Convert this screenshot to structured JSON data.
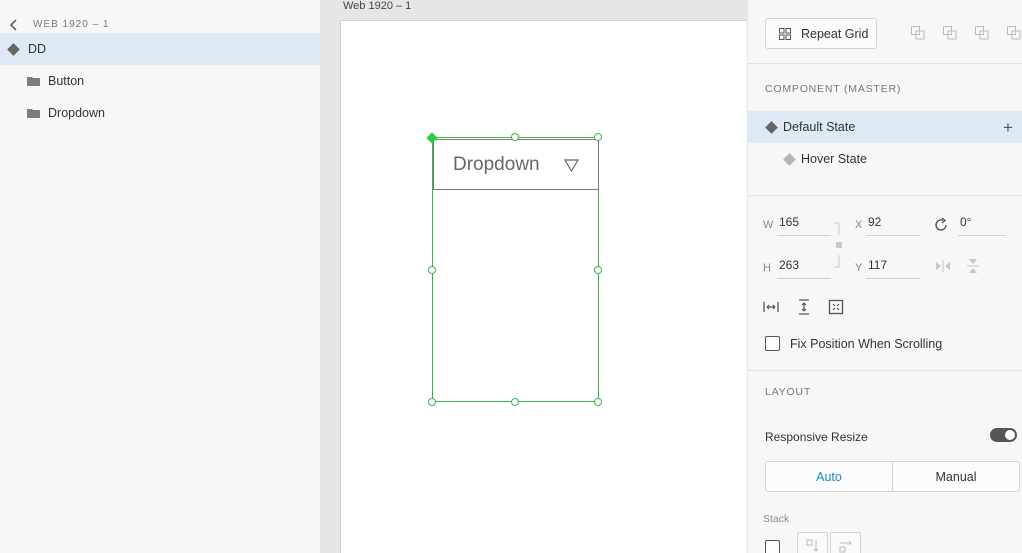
{
  "layers_panel": {
    "header": "WEB 1920 – 1",
    "items": [
      {
        "label": "DD",
        "icon": "component-diamond-icon",
        "selected": true
      },
      {
        "label": "Button",
        "icon": "folder-icon"
      },
      {
        "label": "Dropdown",
        "icon": "folder-icon"
      }
    ]
  },
  "canvas": {
    "artboard_label": "Web 1920 – 1",
    "dropdown_text": "Dropdown",
    "caret_icon": "triangle-down-icon",
    "selection_color": "#3db34a"
  },
  "properties": {
    "repeat_grid_label": "Repeat Grid",
    "component_section_title": "COMPONENT (MASTER)",
    "states": [
      {
        "label": "Default State",
        "selected": true
      },
      {
        "label": "Hover State"
      }
    ],
    "dimensions": {
      "w_label": "W",
      "w": "165",
      "h_label": "H",
      "h": "263",
      "x_label": "X",
      "x": "92",
      "y_label": "Y",
      "y": "117",
      "rotation": "0°"
    },
    "fix_position_label": "Fix Position When Scrolling",
    "layout_section_title": "LAYOUT",
    "responsive_resize_label": "Responsive Resize",
    "responsive_resize_on": true,
    "resize_modes": [
      "Auto",
      "Manual"
    ],
    "active_mode": "Auto",
    "stack_label": "Stack",
    "accent_color": "#1d8ac9"
  }
}
